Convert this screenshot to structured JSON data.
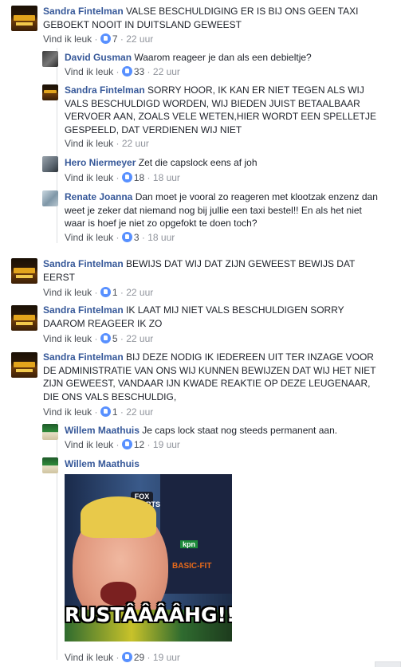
{
  "like_label": "Vind ik leuk",
  "separator": "·",
  "comments": [
    {
      "name": "Sandra Fintelman",
      "text": "VALSE BESCHULDIGING ER IS BIJ ONS GEEN TAXI GEBOEKT NOOIT IN DUITSLAND GEWEEST",
      "likes": "7",
      "time": "22 uur"
    },
    {
      "name": "David Gusman",
      "text": "Waarom reageer je dan als een debieltje?",
      "likes": "33",
      "time": "22 uur"
    },
    {
      "name": "Sandra Fintelman",
      "text": "SORRY HOOR, IK KAN ER NIET TEGEN ALS WIJ VALS BESCHULDIGD WORDEN, WIJ BIEDEN JUIST BETAALBAAR VERVOER AAN, ZOALS VELE WETEN,HIER WORDT EEN SPELLETJE GESPEELD, DAT VERDIENEN WIJ NIET",
      "time": "22 uur"
    },
    {
      "name": "Hero Niermeyer",
      "text": "Zet die capslock eens af joh",
      "likes": "18",
      "time": "18 uur"
    },
    {
      "name": "Renate Joanna",
      "text": "Dan moet je vooral zo reageren met klootzak enzenz dan weet je zeker dat niemand nog bij jullie een taxi bestel!! En als het niet waar is hoef je niet zo opgefokt te doen toch?",
      "likes": "3",
      "time": "18 uur"
    },
    {
      "name": "Sandra Fintelman",
      "text": "BEWIJS DAT WIJ DAT ZIJN GEWEEST BEWIJS DAT EERST",
      "likes": "1",
      "time": "22 uur"
    },
    {
      "name": "Sandra Fintelman",
      "text": "IK LAAT MIJ NIET VALS BESCHULDIGEN SORRY DAAROM REAGEER IK ZO",
      "likes": "5",
      "time": "22 uur"
    },
    {
      "name": "Sandra Fintelman",
      "text": "BIJ DEZE NODIG IK IEDEREEN UIT TER INZAGE VOOR DE ADMINISTRATIE VAN ONS WIJ KUNNEN BEWIJZEN DAT WIJ HET NIET ZIJN GEWEEST, VANDAAR IJN KWADE REAKTIE OP DEZE LEUGENAAR, DIE ONS VALS BESCHULDIG,",
      "likes": "1",
      "time": "22 uur"
    },
    {
      "name": "Willem Maathuis",
      "text": "Je caps lock staat nog steeds permanent aan.",
      "likes": "12",
      "time": "19 uur"
    },
    {
      "name": "Willem Maathuis",
      "image_caption": "RUSTÂÂÂÂHG!!",
      "image_logos": {
        "fox": "FOX SPORTS",
        "kpn": "kpn",
        "basic": "BASIC-FIT"
      },
      "likes": "29",
      "time": "19 uur"
    }
  ],
  "colors": {
    "name": "#365899",
    "text": "#1d2129",
    "meta": "#90949c",
    "like_icon": "#5890ff"
  }
}
